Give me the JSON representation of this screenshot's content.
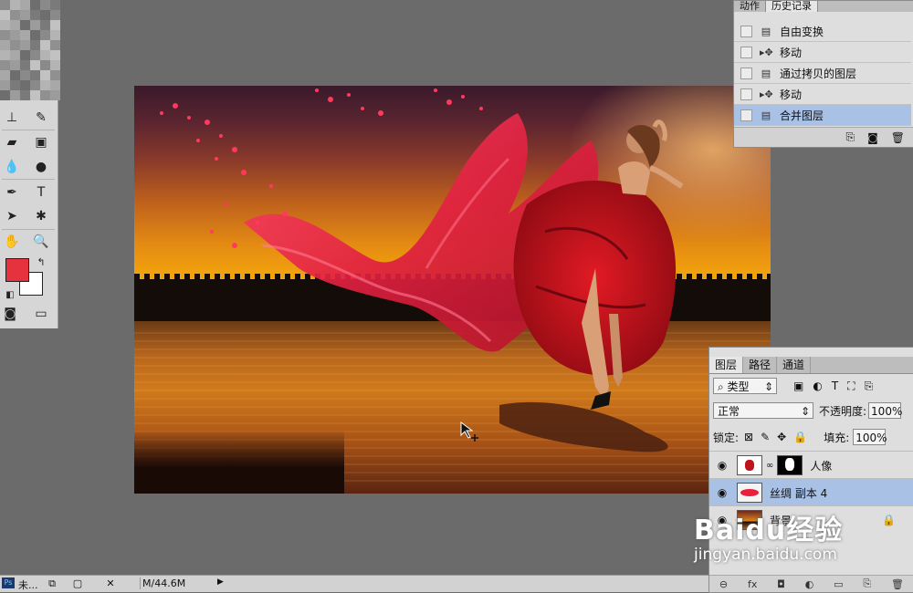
{
  "history_panel": {
    "tabs": [
      "动作",
      "历史记录"
    ],
    "items": [
      {
        "label": "自由变换",
        "icon": "document-icon",
        "selected": false
      },
      {
        "label": "移动",
        "icon": "move-icon",
        "selected": false
      },
      {
        "label": "通过拷贝的图层",
        "icon": "document-icon",
        "selected": false
      },
      {
        "label": "移动",
        "icon": "move-icon",
        "selected": false
      },
      {
        "label": "合并图层",
        "icon": "document-icon",
        "selected": true
      }
    ]
  },
  "layers_panel": {
    "tabs": [
      "图层",
      "路径",
      "通道"
    ],
    "filter": {
      "label": "类型"
    },
    "blend_mode": "正常",
    "opacity_label": "不透明度:",
    "opacity_value": "100%",
    "lock_label": "锁定:",
    "fill_label": "填充:",
    "fill_value": "100%",
    "layers": [
      {
        "name": "人像",
        "visible": true,
        "selected": false,
        "has_mask": true
      },
      {
        "name": "丝绸 副本 4",
        "visible": true,
        "selected": true,
        "has_mask": false
      },
      {
        "name": "背景",
        "visible": true,
        "selected": false,
        "locked": true
      }
    ]
  },
  "tools": {
    "foreground_color": "#e6323e",
    "background_color": "#ffffff"
  },
  "status_bar": {
    "doc_tab": "未...",
    "doc_info": "M/44.6M"
  },
  "watermark": {
    "logo": "Baidu经验",
    "url": "jingyan.baidu.com"
  },
  "colors": {
    "panel_bg": "#dedede",
    "selection": "#a9c1e5",
    "workspace": "#6b6b6b"
  }
}
